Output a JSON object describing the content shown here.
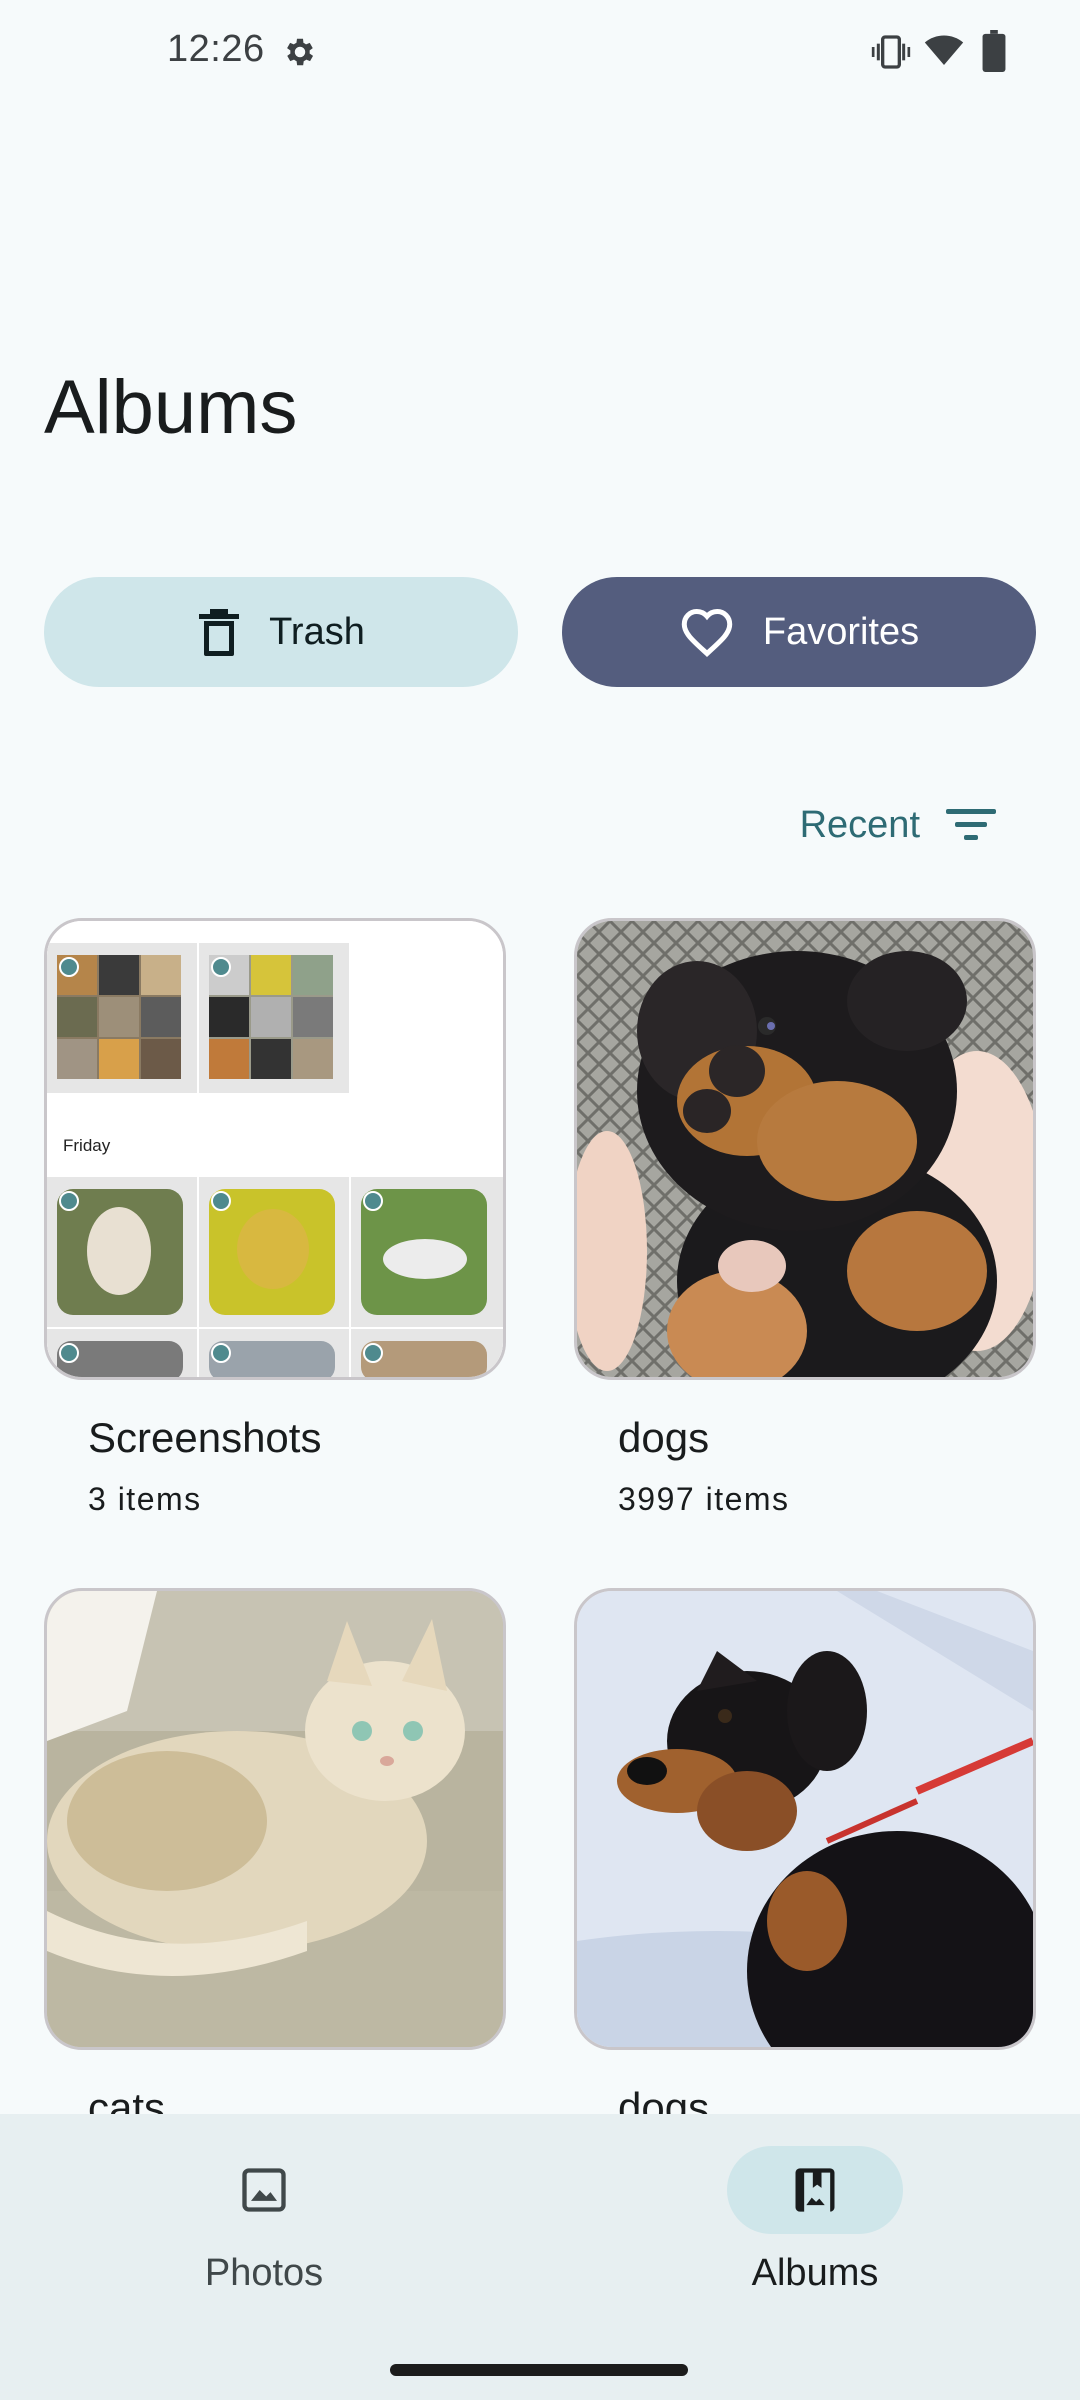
{
  "status_bar": {
    "time": "12:26",
    "icons": [
      "gear-icon",
      "vibrate-icon",
      "wifi-icon",
      "battery-icon"
    ]
  },
  "page": {
    "title": "Albums"
  },
  "actions": {
    "trash_label": "Trash",
    "favorites_label": "Favorites"
  },
  "sort": {
    "label": "Recent",
    "icon": "filter-list-icon"
  },
  "albums": [
    {
      "name": "Screenshots",
      "count": "3 items",
      "thumb_caption": "Friday"
    },
    {
      "name": "dogs",
      "count": "3997 items"
    },
    {
      "name": "cats",
      "count": ""
    },
    {
      "name": "dogs",
      "count": ""
    }
  ],
  "bottom_nav": {
    "items": [
      {
        "label": "Photos",
        "icon": "photo-icon",
        "active": false
      },
      {
        "label": "Albums",
        "icon": "photo-album-icon",
        "active": true
      }
    ]
  },
  "colors": {
    "background": "#f6fafb",
    "trash_button": "#cfe6ea",
    "favorites_button": "#545d7e",
    "accent": "#2e6b74",
    "nav_background": "#e7eff1"
  }
}
